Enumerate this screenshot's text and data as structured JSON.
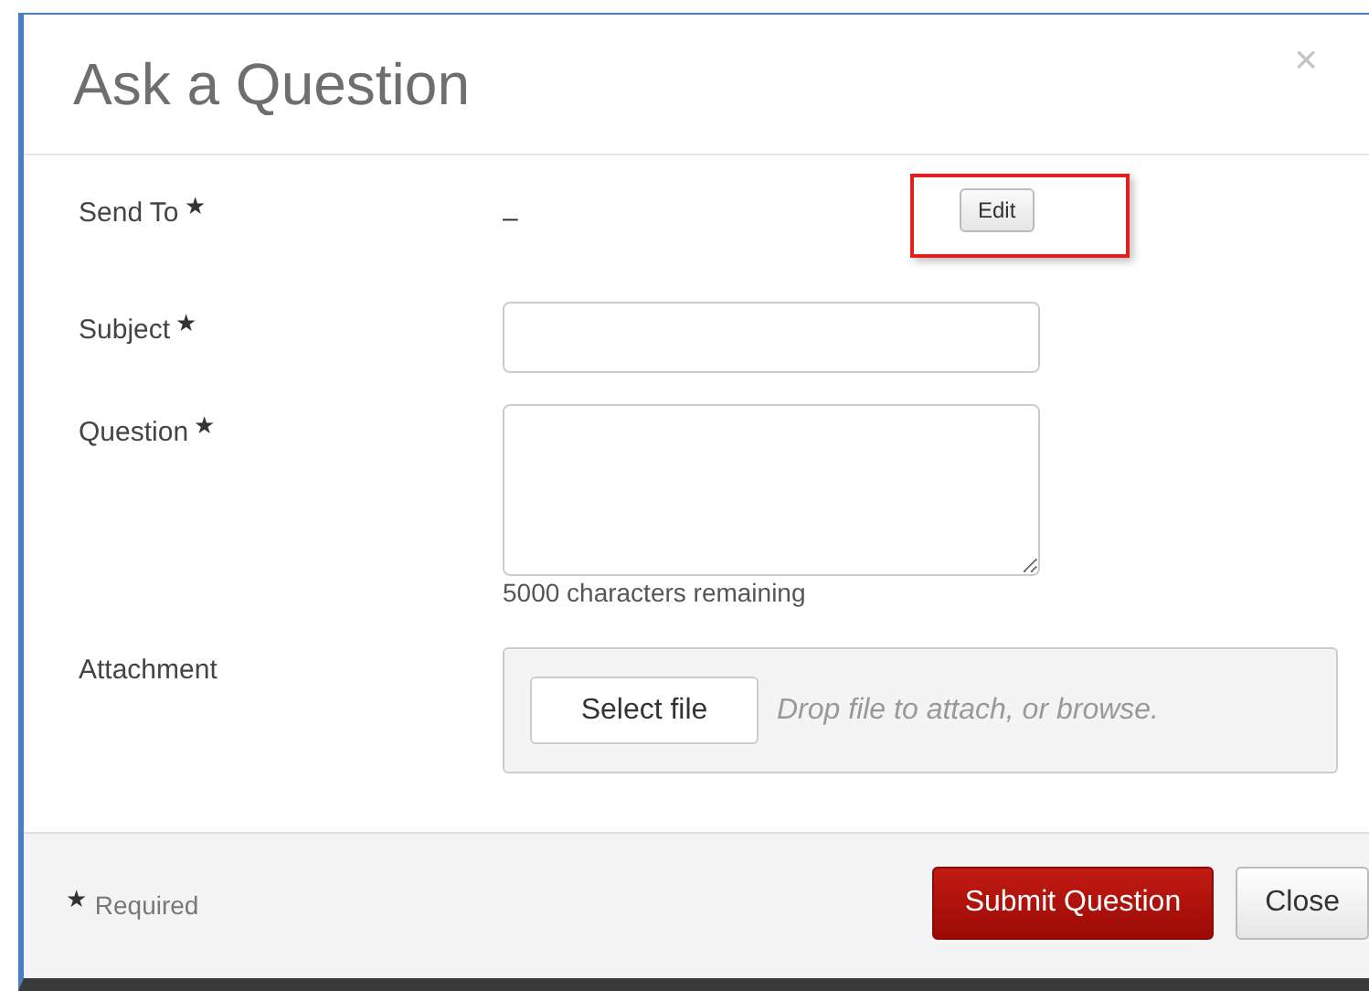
{
  "dialog": {
    "title": "Ask a Question",
    "close": "×"
  },
  "fields": [
    {
      "kind": "value",
      "label": "Send To",
      "required_mark": "★",
      "value": "–",
      "button": "Edit",
      "highlighted": true
    },
    {
      "kind": "input",
      "label": "Subject",
      "required_mark": "★"
    },
    {
      "kind": "textarea",
      "label": "Question",
      "required_mark": "★",
      "counter": "5000 characters remaining"
    },
    {
      "kind": "file",
      "label": "Attachment",
      "button": "Select file",
      "hint": "Drop file to attach, or browse."
    }
  ],
  "footer": {
    "required_mark": "★",
    "required_note": "Required",
    "buttons": [
      {
        "label": "Submit Question",
        "kind": "primary"
      },
      {
        "label": "Close",
        "kind": "default"
      }
    ]
  }
}
